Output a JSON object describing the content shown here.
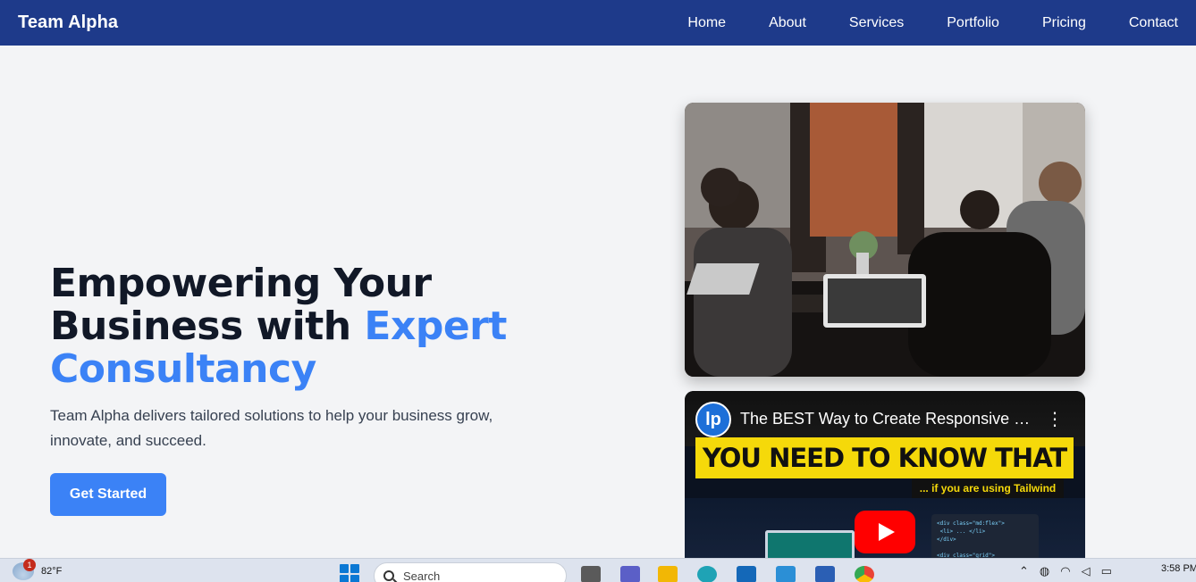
{
  "nav": {
    "brand": "Team Alpha",
    "links": [
      {
        "label": "Home"
      },
      {
        "label": "About"
      },
      {
        "label": "Services"
      },
      {
        "label": "Portfolio"
      },
      {
        "label": "Pricing"
      },
      {
        "label": "Contact"
      }
    ]
  },
  "hero": {
    "title_part1": "Empowering Your Business with ",
    "title_accent": "Expert Consultancy",
    "subtitle": "Team Alpha delivers tailored solutions to help your business grow, innovate, and succeed.",
    "cta_label": "Get Started",
    "accent_color": "#3b82f6",
    "nav_color": "#1e3a8a"
  },
  "video": {
    "channel_initials": "lp",
    "title": "The BEST Way to Create Responsive D...",
    "banner_text": "YOU NEED TO KNOW THAT",
    "sub_tag": "... if you are using Tailwind",
    "code_snippet": "<div class=\"md:flex\">\n <li> ... </li>\n</div>\n\n<div class=\"grid\">"
  },
  "taskbar": {
    "weather_temp": "82°F",
    "weather_badge": "1",
    "search_placeholder": "Search",
    "clock_time": "3:58 PM"
  }
}
